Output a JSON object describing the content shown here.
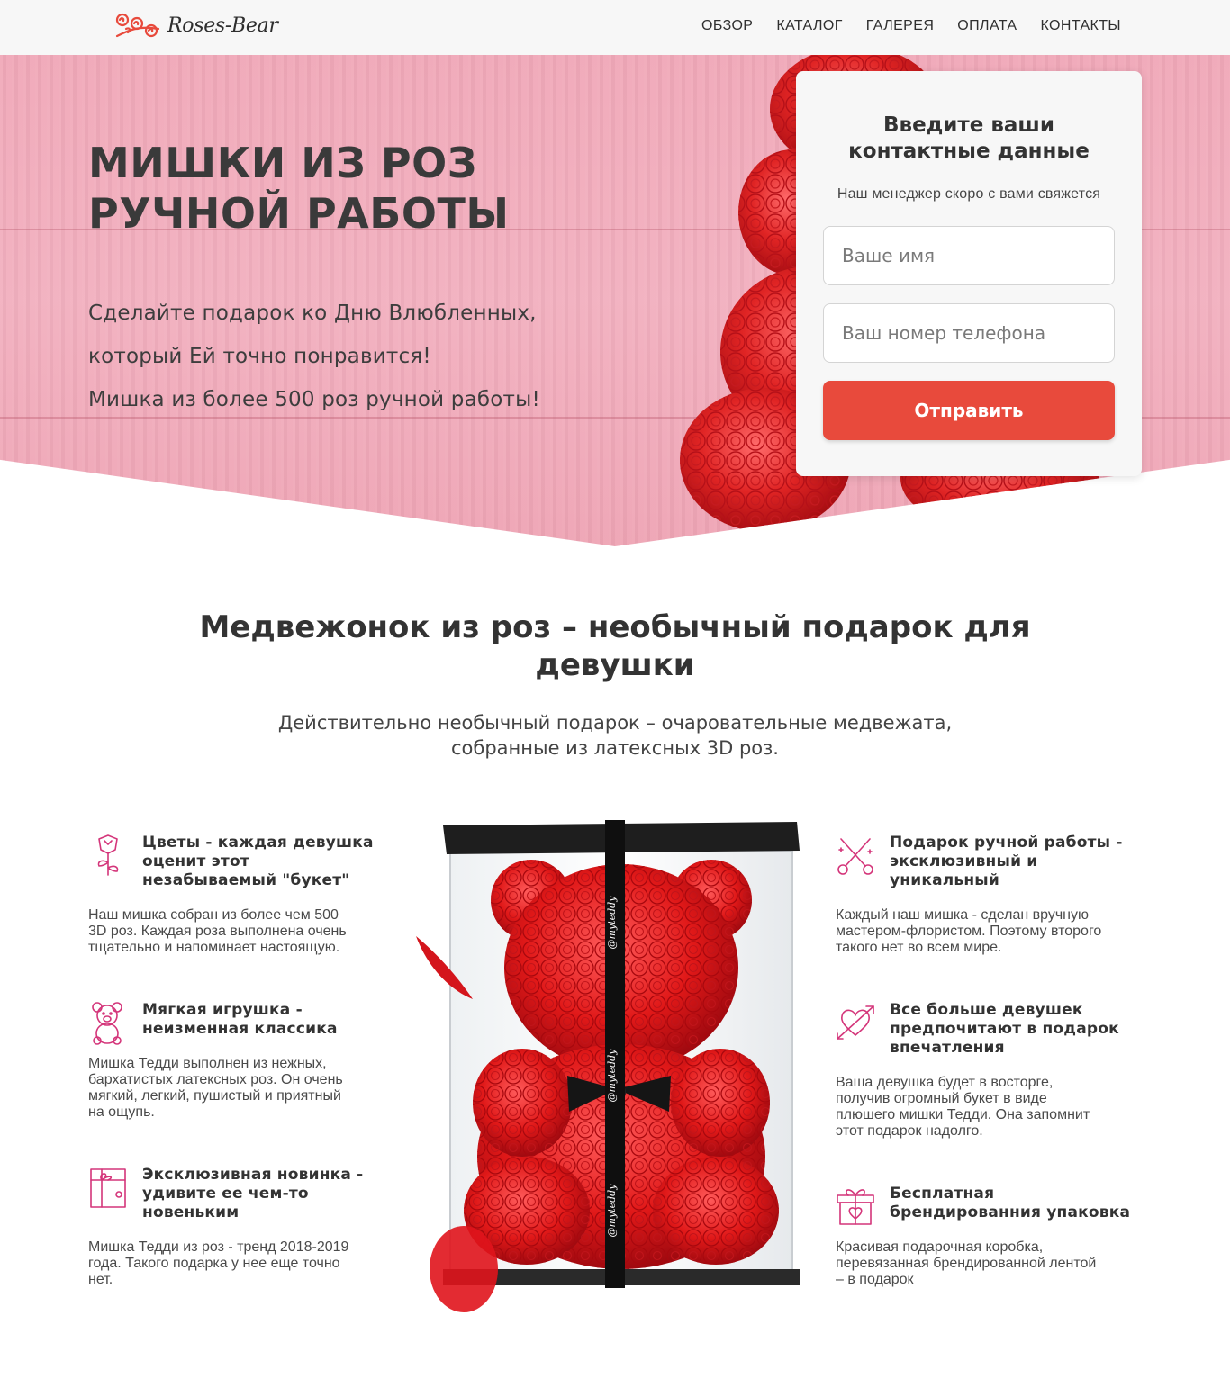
{
  "header": {
    "logo_text": "Roses-Bear",
    "nav": [
      "ОБЗОР",
      "КАТАЛОГ",
      "ГАЛЕРЕЯ",
      "ОПЛАТА",
      "КОНТАКТЫ"
    ]
  },
  "hero": {
    "title_line1": "МИШКИ ИЗ РОЗ",
    "title_line2": "РУЧНОЙ РАБОТЫ",
    "lines": [
      "Сделайте подарок ко Дню Влюбленных,",
      "который Ей точно понравится!",
      "Мишка из более 500 роз ручной работы!"
    ]
  },
  "form": {
    "title_line1": "Введите ваши",
    "title_line2": "контактные данные",
    "subtitle": "Наш менеджер скоро с вами свяжется",
    "name_placeholder": "Ваше имя",
    "phone_placeholder": "Ваш номер телефона",
    "submit_label": "Отправить"
  },
  "section": {
    "title_line1": "Медвежонок из роз – необычный подарок для",
    "title_line2": "девушки",
    "subtitle_line1": "Действительно необычный подарок – очаровательные медвежата,",
    "subtitle_line2": "собранные из латексных 3D роз."
  },
  "features_left": [
    {
      "icon": "rose-icon",
      "title": [
        "Цветы - каждая девушка",
        "оценит этот",
        "незабываемый \"букет\""
      ],
      "text": [
        "Наш мишка собран из более чем 500",
        "3D роз. Каждая роза выполнена очень",
        "тщательно и напоминает настоящую."
      ]
    },
    {
      "icon": "teddy-bear-icon",
      "title": [
        "Мягкая игрушка -",
        "неизменная классика"
      ],
      "text": [
        "Мишка Тедди выполнен из нежных,",
        "бархатистых латексных роз. Он очень",
        "мягкий, легкий, пушистый и приятный",
        "на ощупь."
      ]
    },
    {
      "icon": "gift-box-icon",
      "title": [
        "Эксклюзивная новинка -",
        "удивите ее чем-то",
        "новеньким"
      ],
      "text": [
        "Мишка Тедди из роз - тренд 2018-2019",
        "года. Такого подарка у нее еще точно",
        "нет."
      ]
    }
  ],
  "features_right": [
    {
      "icon": "scissors-icon",
      "title": [
        "Подарок ручной работы -",
        "эксклюзивный и",
        "уникальный"
      ],
      "text": [
        "Каждый наш мишка - сделан вручную",
        "мастером-флористом. Поэтому второго",
        "такого нет во всем мире."
      ]
    },
    {
      "icon": "heart-arrow-icon",
      "title": [
        "Все больше девушек",
        "предпочитают в подарок",
        "впечатления"
      ],
      "text": [
        "Ваша девушка будет в восторге,",
        "получив огромный букет в виде",
        "плюшего мишки Тедди. Она запомнит",
        "этот подарок надолго."
      ]
    },
    {
      "icon": "gift-heart-icon",
      "title": [
        "Бесплатная",
        "брендированния упаковка"
      ],
      "text": [
        "Красивая подарочная коробка,",
        "перевязанная брендированной лентой",
        "– в подарок"
      ]
    }
  ],
  "product": {
    "ribbon_text": "@myteddy"
  },
  "colors": {
    "accent": "#e84a3c",
    "hero_pink": "#f2b0bf",
    "rose_red": "#e02424",
    "icon_pink": "#d4357a"
  }
}
